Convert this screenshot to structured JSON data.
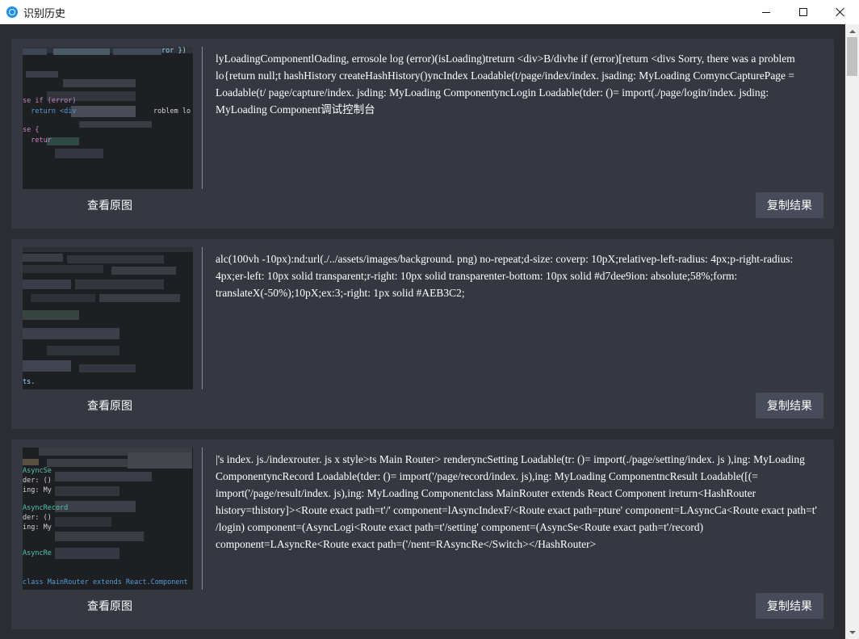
{
  "window": {
    "title": "识别历史",
    "icon": "app-logo-icon",
    "controls": [
      "minimize-icon",
      "maximize-icon",
      "close-icon"
    ]
  },
  "records": [
    {
      "view_label": "查看原图",
      "copy_label": "复制结果",
      "text": "lyLoadingComponentlOading, errosole log (error)(isLoading)treturn <div>B/divhe if (error)[return <divs Sorry, there was a problem lo{return null;t hashHistory createHashHistory()yncIndex Loadable(t/page/index/index. jsading: MyLoading ComyncCapturePage = Loadable(t/ page/capture/index. jsding: MyLoading ComponentyncLogin Loadable(tder: ()= import(./page/login/index. jsding: MyLoading Component调试控制台"
    },
    {
      "view_label": "查看原图",
      "copy_label": "复制结果",
      "text": "alc(100vh -10px):nd:url(./../assets/images/background. png) no-repeat;d-size: coverp: 10pX;relativep-left-radius: 4px;p-right-radius: 4px;er-left: 10px solid transparent;r-right: 10px solid transparenter-bottom: 10px solid #d7dee9ion: absolute;58%;form: translateX(-50%);10pX;ex:3;-right: 1px solid #AEB3C2;"
    },
    {
      "view_label": "查看原图",
      "copy_label": "复制结果",
      "text": "|'s index. js./indexrouter. js x style>ts Main Router> renderyncSetting Loadable(tr: ()= import(./page/setting/index. js ),ing: MyLoading ComponentyncRecord Loadable(tder: ()= import('/page/record/index. js),ing: MyLoading ComponentncResult Loadable([(= import('/page/result/index. js),ing: MyLoading Componentclass MainRouter extends React Component ireturn<HashRouter history=thistory]><Route exact path=t'/' component=lAsyncIndexF/<Route exact path=pture' component=LAsyncCa<Route exact path=t' /login) component=(AsyncLogi<Route exact path=t'/setting' component=(AsyncSe<Route exact path=t'/record) component=LAsyncRe<Route exact path=('/nent=RAsyncRe</Switch></HashRouter>"
    }
  ],
  "thumbnails": [
    {
      "code": [
        {
          "text": "ror })",
          "color": "#9cdcfe"
        },
        {
          "text": "se if (error)",
          "color": "#c586c0"
        },
        {
          "text": "  return <div",
          "color": "#569cd6"
        },
        {
          "text": "roblem lo",
          "color": "#d4d4d4"
        },
        {
          "text": "se {",
          "color": "#c586c0"
        },
        {
          "text": "  retur",
          "color": "#c586c0"
        }
      ]
    },
    {
      "code": [
        {
          "text": "ts.",
          "color": "#9cdcfe"
        }
      ]
    },
    {
      "code": [
        {
          "text": "AsyncSe",
          "color": "#4ec9b0"
        },
        {
          "text": "der: ()",
          "color": "#d4d4d4"
        },
        {
          "text": "ing: My",
          "color": "#d4d4d4"
        },
        {
          "text": "AsyncRecord",
          "color": "#4ec9b0"
        },
        {
          "text": "der: ()",
          "color": "#d4d4d4"
        },
        {
          "text": "ing: My",
          "color": "#d4d4d4"
        },
        {
          "text": "AsyncRe",
          "color": "#4ec9b0"
        },
        {
          "text": "class MainRouter extends React.Component {",
          "color": "#569cd6"
        }
      ]
    }
  ],
  "colors": {
    "background": "#2b2d33",
    "card": "#363841",
    "button": "#474b5a",
    "accent": "#1e8ef0"
  }
}
